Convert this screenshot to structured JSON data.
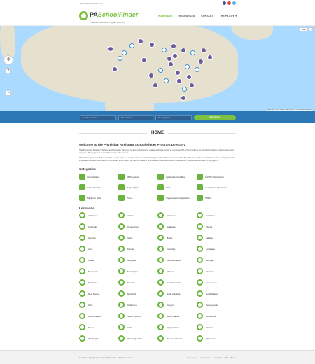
{
  "topbar": {
    "url": "www.paschoolfinder.com"
  },
  "social": [
    {
      "name": "facebook-icon",
      "color": "#3b5998"
    },
    {
      "name": "googleplus-icon",
      "color": "#dd4b39"
    },
    {
      "name": "twitter-icon",
      "color": "#55acee"
    }
  ],
  "logo": {
    "pa": "PA",
    "school_finder": "SchoolFinder",
    "tagline": "Physician Assistant Program Directory"
  },
  "nav": [
    "HOMEPAGE",
    "RESOURCES",
    "CONTACT",
    "THE PA LIFE"
  ],
  "map": {
    "zoom_in": "+",
    "zoom_out": "−",
    "type": "Map",
    "fullscreen": "⛶",
    "attribution": "Map data ©2015 Google, INEGI  Terms of Use  Report a map error"
  },
  "search": {
    "placeholder": "Search keyword",
    "filter1": "All locations",
    "filter2": "All categories",
    "button": "SEARCH"
  },
  "home": {
    "heading": "HOME",
    "welcome": "Welcome to the Physician Assistant School Finder Program Directory",
    "p1": "The Physician Assistant School and Program Directory is a comprehensive and searchable guide to physician PA school options, current information on accredited and expected PA programs in the U.S. and in other areas.",
    "p2": "This directory now includes specific search tools to sort by location, detailed program information and standards. The directory includes individual entries categorized for Physician Assistant education and contact information, as well as several accreditation, admissions and institutional requirements of each PA program.",
    "categories_title": "Categories",
    "locations_title": "Locations"
  },
  "categories": [
    "Accreditation",
    "All Programs",
    "Application Deadline",
    "CASPA Participation",
    "Class Duration",
    "Degree Type",
    "GRE",
    "Health Care Experience",
    "Minimum GPA",
    "Prices",
    "Supplemental Application",
    "TOEFL"
  ],
  "locations": [
    "Alabama",
    "Arizona",
    "Arkansas",
    "California",
    "Colorado",
    "Connecticut",
    "Delaware",
    "Florida",
    "Georgia",
    "Idaho",
    "Illinois",
    "Indiana",
    "Iowa",
    "Kansas",
    "Kentucky",
    "Louisiana",
    "Maine",
    "Maryland",
    "Massachusetts",
    "Michigan",
    "Minnesota",
    "Mississippi",
    "Missouri",
    "Montana",
    "Nebraska",
    "Nevada",
    "New Hampshire",
    "New Jersey",
    "New Mexico",
    "New York",
    "North Carolina",
    "North Dakota",
    "Ohio",
    "Oklahoma",
    "Oregon",
    "Pennsylvania",
    "Rhode Island",
    "South Carolina",
    "South Dakota",
    "Tennessee",
    "Texas",
    "Utah",
    "Virgin Islands",
    "Virginia",
    "Washington",
    "Washington DC",
    "Western Virginia",
    "Wisconsin"
  ],
  "footer": {
    "copyright": "© 2015 Copyright by paschoolfinder.com  All rights reserved.",
    "links": [
      "Homepage",
      "Resources",
      "Contact",
      "The PA Life"
    ]
  },
  "colors": {
    "accent": "#7cc13f",
    "search": "#2c78b7",
    "map_water": "#aadaff"
  }
}
